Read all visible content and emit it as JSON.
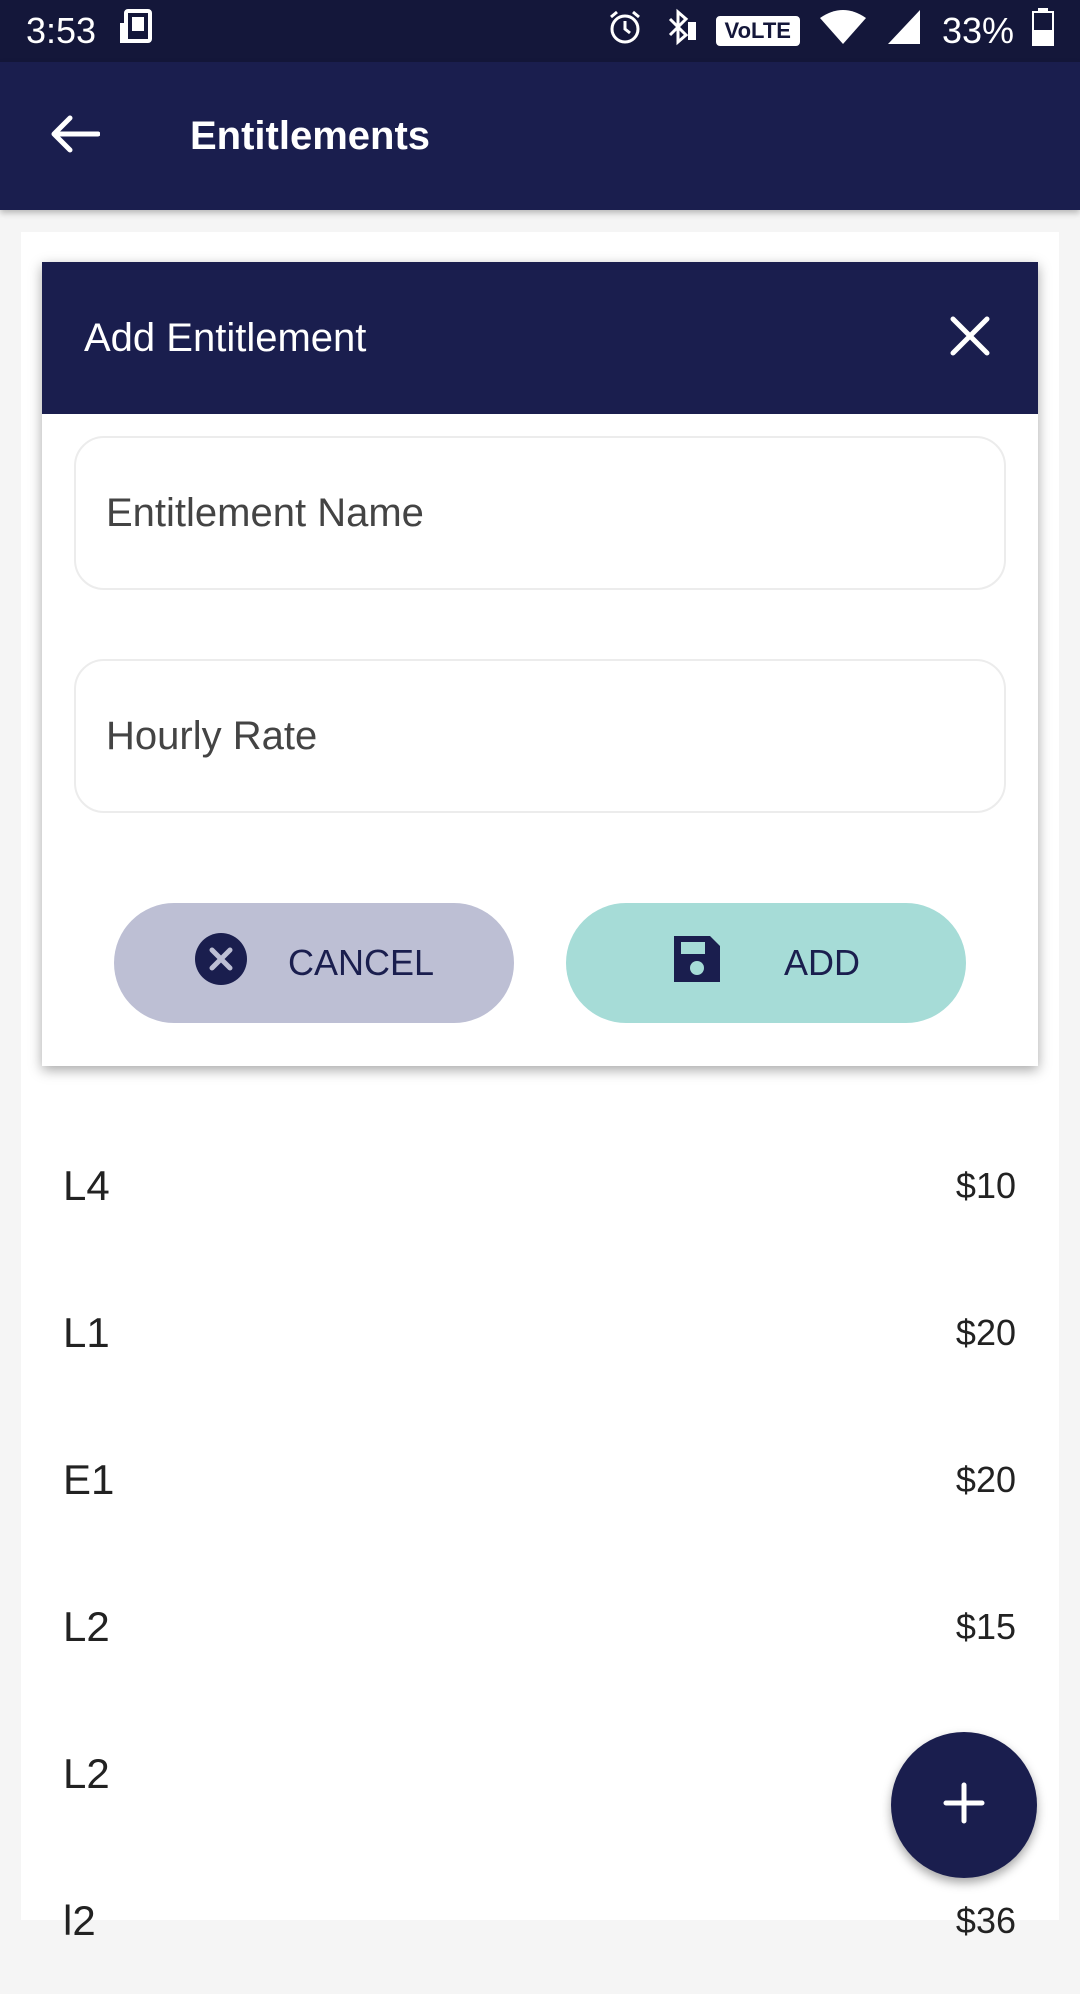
{
  "status_bar": {
    "time": "3:53",
    "volte": "VoLTE",
    "battery": "33%"
  },
  "app_bar": {
    "title": "Entitlements"
  },
  "dialog": {
    "title": "Add Entitlement",
    "name_placeholder": "Entitlement Name",
    "rate_placeholder": "Hourly Rate",
    "cancel_label": "CANCEL",
    "add_label": "ADD"
  },
  "entitlements": [
    {
      "name": "L4",
      "rate": "$10"
    },
    {
      "name": "L1",
      "rate": "$20"
    },
    {
      "name": "E1",
      "rate": "$20"
    },
    {
      "name": "L2",
      "rate": "$15"
    },
    {
      "name": "L2",
      "rate": ""
    },
    {
      "name": "l2",
      "rate": "$36"
    }
  ],
  "icons": {
    "back": "arrow-left-icon",
    "close": "close-icon",
    "cancel": "cancel-circle-icon",
    "save": "floppy-disk-icon",
    "fab": "plus-icon"
  },
  "colors": {
    "primary": "#1a1e4e",
    "cancel_bg": "#bdbfd4",
    "add_bg": "#a6dcd7"
  }
}
